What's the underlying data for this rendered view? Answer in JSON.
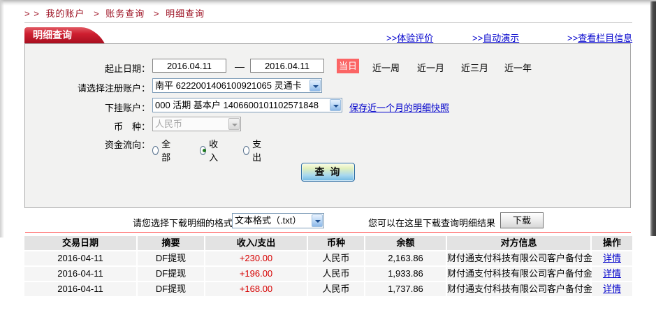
{
  "breadcrumb": {
    "prefix": "> >",
    "separator": ">",
    "items": [
      "我的账户",
      "账务查询",
      "明细查询"
    ]
  },
  "panel": {
    "tab_title": "明细查询",
    "links": [
      {
        "prefix": ">>",
        "label": "体验评价"
      },
      {
        "prefix": ">>",
        "label": "自动演示"
      },
      {
        "prefix": ">>",
        "label": "查看栏目信息"
      }
    ]
  },
  "form": {
    "date_range": {
      "label": "起止日期：",
      "from": "2016.04.11",
      "dash": "—",
      "to": "2016.04.11",
      "today_badge": "当日",
      "quick_links": [
        "近一周",
        "近一月",
        "近三月",
        "近一年"
      ]
    },
    "register_account": {
      "label": "请选择注册账户：",
      "value": "南平 6222001406100921065 灵通卡"
    },
    "sub_account": {
      "label": "下挂账户：",
      "value": "000 活期 基本户 1406600101102571848",
      "snapshot_link": "保存近一个月的明细快照"
    },
    "currency": {
      "label": "币　种：",
      "value": "人民币",
      "disabled": true
    },
    "flow": {
      "label": "资金流向：",
      "options": [
        {
          "label": "全部",
          "checked": false
        },
        {
          "label": "收入",
          "checked": true
        },
        {
          "label": "支出",
          "checked": false
        }
      ]
    },
    "query_button": "查 询"
  },
  "download": {
    "format_label": "请您选择下载明细的格式",
    "format_value": "文本格式（.txt）",
    "hint": "您可以在这里下载查询明细结果",
    "button": "下载"
  },
  "table": {
    "headers": [
      "交易日期",
      "摘要",
      "收入/支出",
      "币种",
      "余额",
      "对方信息",
      "操作"
    ],
    "rows": [
      {
        "date": "2016-04-11",
        "summary": "DF提现",
        "amount": "+230.00",
        "currency": "人民币",
        "balance": "2,163.86",
        "counterparty": "财付通支付科技有限公司客户备付金",
        "action": "详情"
      },
      {
        "date": "2016-04-11",
        "summary": "DF提现",
        "amount": "+196.00",
        "currency": "人民币",
        "balance": "1,933.86",
        "counterparty": "财付通支付科技有限公司客户备付金",
        "action": "详情"
      },
      {
        "date": "2016-04-11",
        "summary": "DF提现",
        "amount": "+168.00",
        "currency": "人民币",
        "balance": "1,737.86",
        "counterparty": "财付通支付科技有限公司客户备付金",
        "action": "详情"
      }
    ]
  },
  "colors": {
    "accent_red": "#c7000b",
    "breadcrumb_red": "#9b0c1e",
    "link_blue": "#0000cc",
    "amount_red": "#d60000",
    "badge_bg": "#fb6565",
    "panel_bg": "#f2f2f1",
    "table_header_bg": "#e3e3e3",
    "table_row_bg": "#f5f5f5"
  }
}
